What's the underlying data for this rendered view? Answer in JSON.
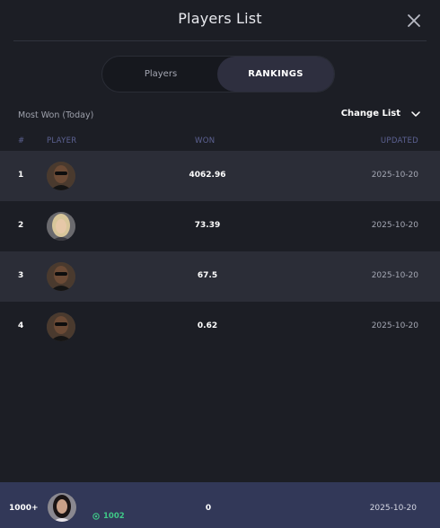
{
  "header": {
    "title": "Players List",
    "close_label": "close"
  },
  "tabs": [
    {
      "label": "Players",
      "active": false
    },
    {
      "label": "RANKINGS",
      "active": true
    }
  ],
  "filter": {
    "label": "Most Won (Today)",
    "change_list": "Change List"
  },
  "columns": {
    "rank": "#",
    "player": "PLAYER",
    "won": "WON",
    "updated": "UPDATED"
  },
  "rows": [
    {
      "rank": "1",
      "avatar": "avatar-man-sunglasses",
      "won": "4062.96",
      "updated": "2025-10-20"
    },
    {
      "rank": "2",
      "avatar": "avatar-woman-blonde",
      "won": "73.39",
      "updated": "2025-10-20"
    },
    {
      "rank": "3",
      "avatar": "avatar-man-sunglasses",
      "won": "67.5",
      "updated": "2025-10-20"
    },
    {
      "rank": "4",
      "avatar": "avatar-man-sunglasses",
      "won": "0.62",
      "updated": "2025-10-20"
    }
  ],
  "current_user": {
    "rank": "1000+",
    "avatar": "avatar-woman-dark-hair",
    "points": "1002",
    "won": "0",
    "updated": "2025-10-20"
  },
  "colors": {
    "background": "#1c1e25",
    "row_alt": "#2b2d37",
    "footer": "#323858",
    "accent_green": "#3fc887",
    "column_header": "#5d6293"
  }
}
